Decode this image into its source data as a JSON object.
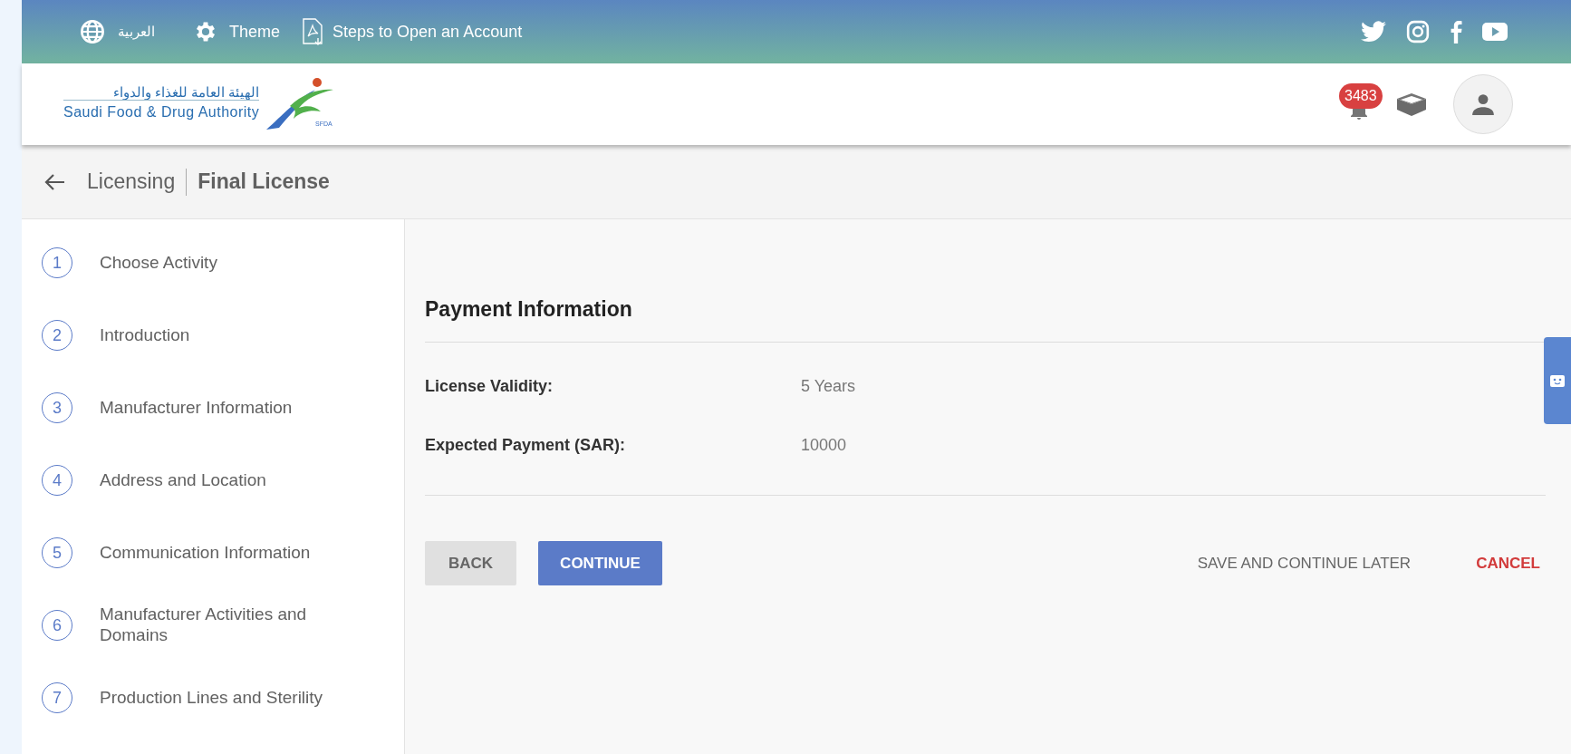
{
  "top_bar": {
    "language": "العربية",
    "theme": "Theme",
    "steps_link": "Steps to Open an Account"
  },
  "header": {
    "logo": {
      "arabic": "الهيئة العامة للغذاء والدواء",
      "english": "Saudi Food & Drug Authority",
      "emblem_text": "SFDA"
    },
    "notification_count": "3483"
  },
  "breadcrumb": [
    "Licensing",
    "Final License"
  ],
  "steps": [
    {
      "number": "1",
      "label": "Choose Activity"
    },
    {
      "number": "2",
      "label": "Introduction"
    },
    {
      "number": "3",
      "label": "Manufacturer Information"
    },
    {
      "number": "4",
      "label": "Address and Location"
    },
    {
      "number": "5",
      "label": "Communication Information"
    },
    {
      "number": "6",
      "label": "Manufacturer Activities and Domains"
    },
    {
      "number": "7",
      "label": "Production Lines and Sterility"
    }
  ],
  "section": {
    "title": "Payment Information",
    "fields": [
      {
        "label": "License Validity:",
        "value": "5 Years"
      },
      {
        "label": "Expected Payment (SAR):",
        "value": "10000"
      }
    ]
  },
  "actions": {
    "back": "BACK",
    "continue": "CONTINUE",
    "save_later": "SAVE AND CONTINUE LATER",
    "cancel": "CANCEL"
  }
}
